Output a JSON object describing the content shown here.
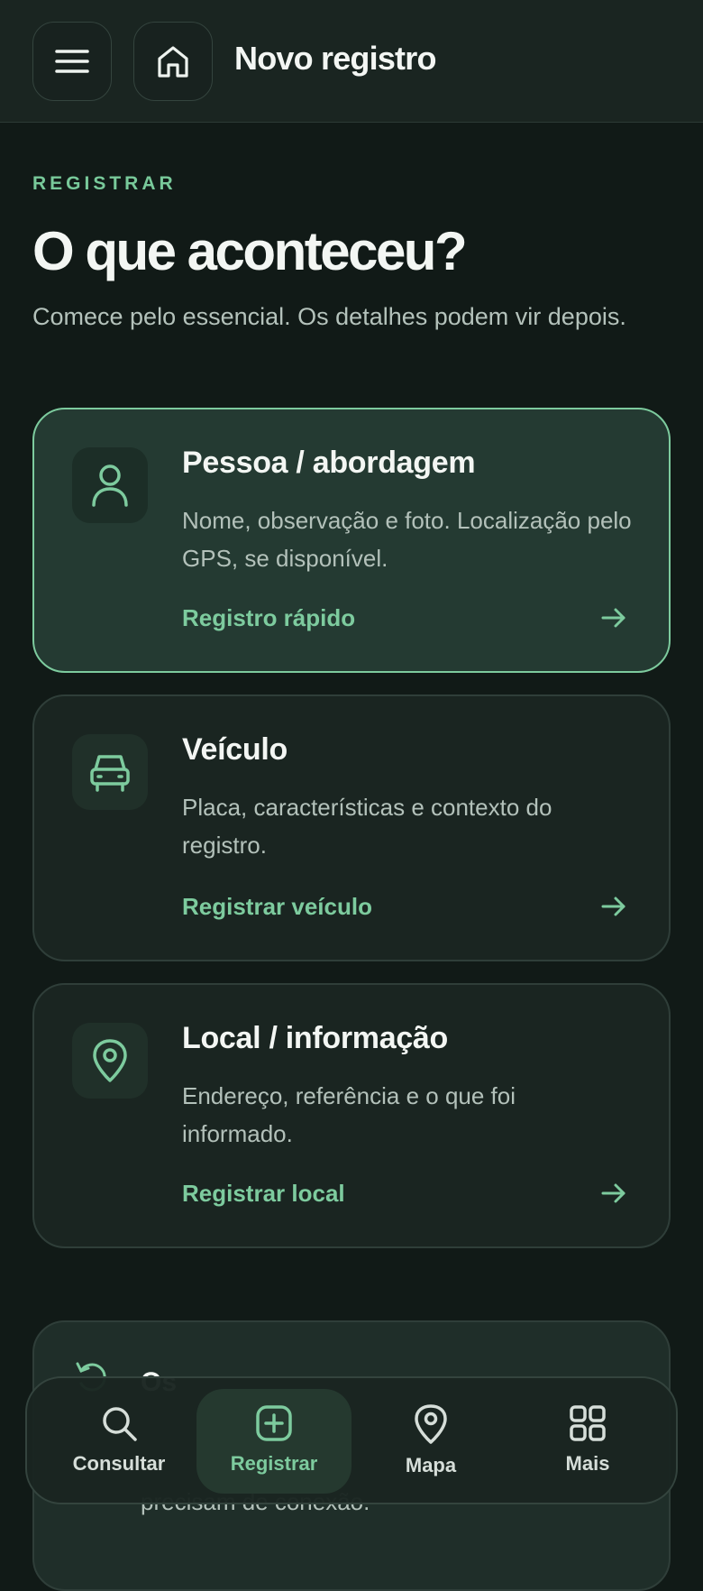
{
  "header": {
    "title": "Novo registro",
    "menu_icon": "hamburger-menu-icon",
    "home_icon": "home-icon"
  },
  "hero": {
    "eyebrow": "REGISTRAR",
    "title": "O que aconteceu?",
    "subtitle": "Comece pelo essencial. Os detalhes podem vir depois."
  },
  "cards": [
    {
      "title": "Pessoa / abordagem",
      "description": "Nome, observação e foto. Localização pelo GPS, se disponível.",
      "action": "Registro rápido",
      "icon": "person-icon"
    },
    {
      "title": "Veículo",
      "description": "Placa, características e contexto do registro.",
      "action": "Registrar veículo",
      "icon": "car-icon"
    },
    {
      "title": "Local / informação",
      "description": "Endereço, referência e o que foi informado.",
      "action": "Registrar local",
      "icon": "location-pin-icon"
    }
  ],
  "sync": {
    "title": "Os",
    "description": "precisam de conexão."
  },
  "nav": [
    {
      "label": "Consultar",
      "icon": "search-icon",
      "active": false
    },
    {
      "label": "Registrar",
      "icon": "add-square-icon",
      "active": true
    },
    {
      "label": "Mapa",
      "icon": "map-pin-icon",
      "active": false
    },
    {
      "label": "Mais",
      "icon": "grid-icon",
      "active": false
    }
  ],
  "colors": {
    "background": "#111a17",
    "accent": "#7dcb9e",
    "surface": "#1a2521",
    "active_card": "#243a32"
  }
}
